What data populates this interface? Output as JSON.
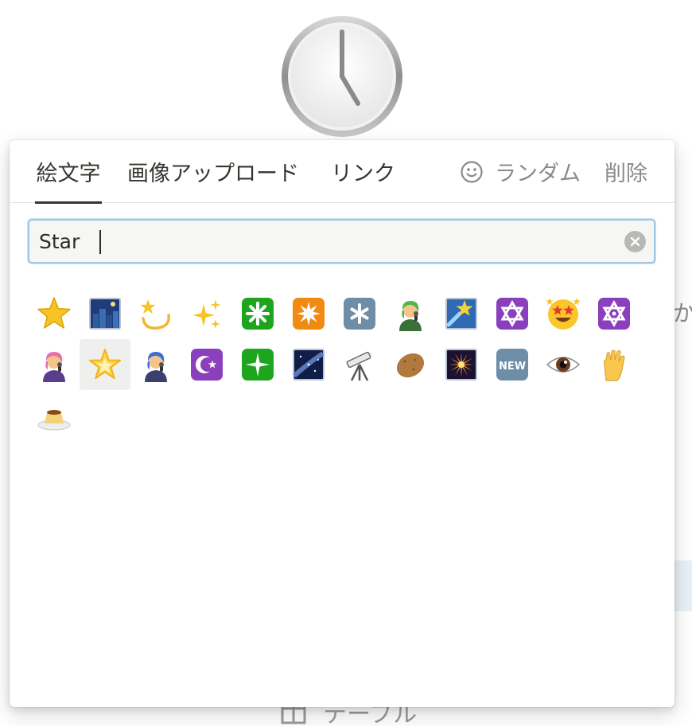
{
  "background": {
    "peek_text": "か",
    "table_item": {
      "icon": "table-icon",
      "label": "テーブル"
    },
    "page_icon": "clock-five-icon"
  },
  "picker": {
    "tabs": [
      {
        "label": "絵文字",
        "active": true
      },
      {
        "label": "画像アップロード",
        "active": false
      },
      {
        "label": "リンク",
        "active": false
      }
    ],
    "actions": {
      "random": {
        "icon": "smiley-icon",
        "label": "ランダム"
      },
      "delete": {
        "label": "削除"
      }
    },
    "search": {
      "value": "Star",
      "clear_icon": "clear-icon"
    },
    "emojis": [
      "star",
      "night-city",
      "dizzy",
      "sparkles",
      "eight-spoked-asterisk",
      "eight-pointed-star",
      "keycap-asterisk",
      "singer-green",
      "shooting-star",
      "star-of-david",
      "star-struck",
      "six-pointed-star",
      "singer-pink",
      "glowing-star",
      "singer-blue",
      "star-and-crescent",
      "sparkle",
      "milky-way",
      "telescope",
      "potato",
      "fireworks",
      "new-button",
      "eye",
      "vulcan-salute",
      "custard"
    ],
    "hovered_emoji": "glowing-star",
    "colors": {
      "tab_text": "#37352f",
      "muted_text": "#8b8a86",
      "focus_ring": "#9ec7e3",
      "input_bg": "#f6f6f5"
    }
  }
}
